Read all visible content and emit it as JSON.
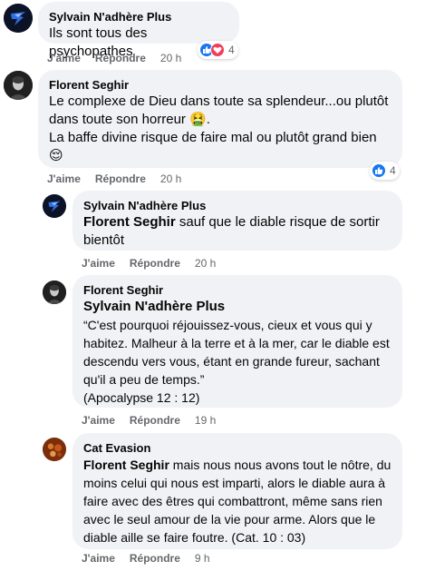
{
  "comments": [
    {
      "author": "Sylvain N'adhère Plus",
      "text": "Ils sont tous des psychopathes",
      "like": "J'aime",
      "reply": "Répondre",
      "time": "20 h",
      "reaction_count": "4",
      "reactions": [
        "like-icon",
        "love-icon"
      ]
    },
    {
      "author": "Florent Seghir",
      "line1": "Le complexe de Dieu dans toute sa splendeur...ou plutôt",
      "line2": "dans toute son horreur",
      "line2_emoji": "🤮",
      "line2_end": ".",
      "line3": "La baffe divine risque de faire mal ou plutôt grand bien",
      "line4_emoji": "😌",
      "like": "J'aime",
      "reply": "Répondre",
      "time": "20 h",
      "reaction_count": "4",
      "reactions": [
        "like-icon"
      ]
    },
    {
      "author": "Sylvain N'adhère Plus",
      "mention": "Florent Seghir",
      "text": " sauf que le diable risque de sortir bientôt",
      "like": "J'aime",
      "reply": "Répondre",
      "time": "20 h"
    },
    {
      "author": "Florent Seghir",
      "mention": "Sylvain N'adhère Plus",
      "text": "“C'est pourquoi réjouissez-vous, cieux et vous qui y habitez. Malheur à la terre et à la mer, car le diable est descendu vers vous, étant en grande fureur, sachant qu'il a peu de temps.”",
      "ref": "(Apocalypse 12 : 12)",
      "like": "J'aime",
      "reply": "Répondre",
      "time": "19 h"
    },
    {
      "author": "Cat Evasion",
      "mention": "Florent Seghir",
      "text": " mais nous nous avons tout le nôtre, du moins celui qui nous est imparti, alors le diable aura à faire avec des êtres qui combattront, même sans rien avec le seul amour de la vie pour arme. Alors que le diable aille se faire foutre. (Cat. 10 : 03)",
      "like": "J'aime",
      "reply": "Répondre",
      "time": "9 h"
    }
  ],
  "colors": {
    "bubble": "#f0f2f5",
    "meta": "#65676b",
    "like_blue": "#1877f2",
    "love_red": "#f33e58"
  }
}
